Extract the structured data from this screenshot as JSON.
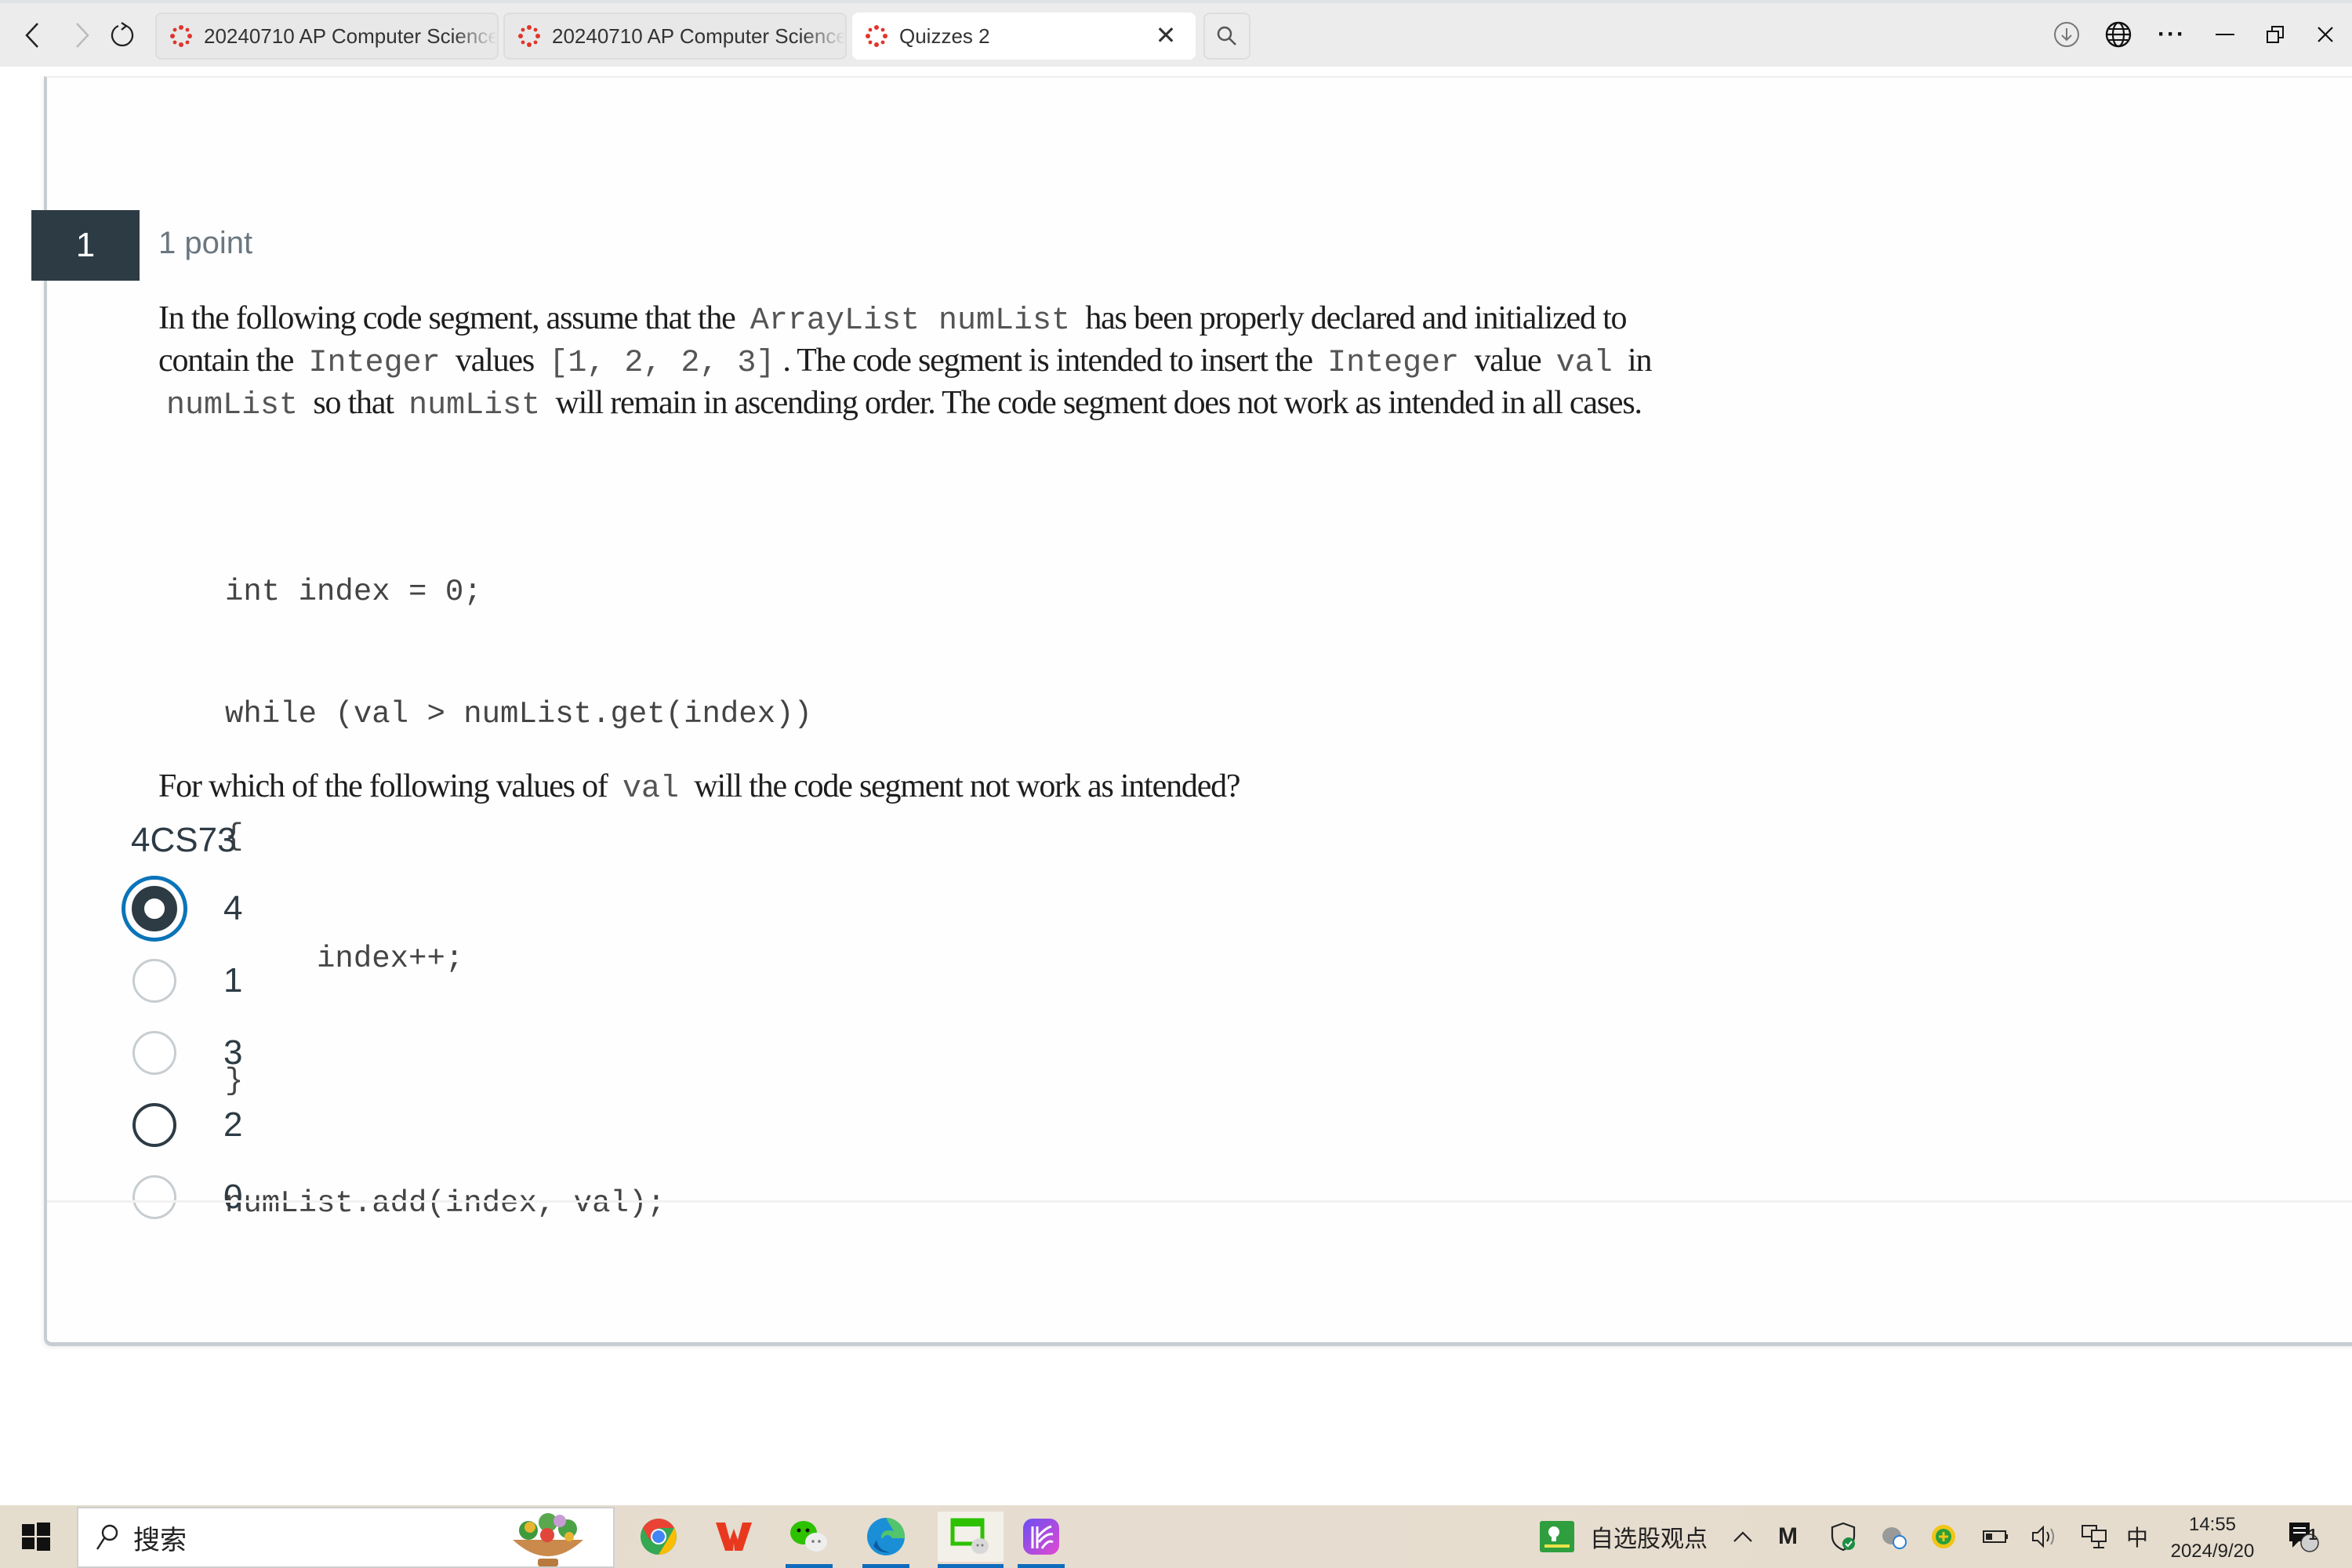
{
  "browser": {
    "tabs": [
      {
        "title": "20240710 AP Computer Science",
        "active": false
      },
      {
        "title": "20240710 AP Computer Science",
        "active": false
      },
      {
        "title": "Quizzes 2",
        "active": true
      }
    ],
    "icons": {
      "back": "chevron-left-icon",
      "forward": "chevron-right-icon",
      "refresh": "refresh-icon",
      "tab_favicon": "canvas-lms-icon",
      "tab_close": "close-icon",
      "tab_search": "search-icon",
      "downloads": "download-icon",
      "translate": "globe-icon",
      "more": "more-dots-icon",
      "minimize": "minimize-icon",
      "restore": "restore-icon",
      "close": "close-icon"
    },
    "glyphs": {
      "back": "‹",
      "forward": "›",
      "tab_close": "✕",
      "more": "···",
      "minimize": "—",
      "close": "✕"
    }
  },
  "question": {
    "number": "1",
    "points": "1 point",
    "text_parts": {
      "p1": "In the following code segment, assume that the",
      "c1": "ArrayList numList",
      "p2": "has been properly declared and initialized to contain the",
      "c2": "Integer",
      "p3": "values",
      "c3": "[1, 2, 2, 3]",
      "p4": ". The code segment is intended to insert the",
      "c4": "Integer",
      "p5": "value",
      "c5": "val",
      "p6": "in",
      "c6": "numList",
      "p7": "so that",
      "c7": "numList",
      "p8": "will remain in ascending order. The code segment does not work as intended in all cases."
    },
    "code_lines": [
      "int index = 0;",
      "while (val > numList.get(index))",
      "{",
      "     index++;",
      "}",
      "numList.add(index, val);"
    ],
    "prompt": {
      "before": "For which of the following values of",
      "code": "val",
      "after": "will the code segment not work as intended?"
    },
    "label": "4CS73",
    "answers": [
      {
        "label": "4",
        "selected": true,
        "hover": false
      },
      {
        "label": "1",
        "selected": false,
        "hover": false
      },
      {
        "label": "3",
        "selected": false,
        "hover": false
      },
      {
        "label": "2",
        "selected": false,
        "hover": true
      },
      {
        "label": "0",
        "selected": false,
        "hover": false
      }
    ],
    "colors": {
      "number_bg": "#2d3b45",
      "focus_ring": "#0a74b9",
      "radio_fill": "#2d3b45",
      "points_text": "#6b7780"
    }
  },
  "taskbar": {
    "search_placeholder": "搜索",
    "apps": [
      {
        "name": "chrome-icon",
        "running": false
      },
      {
        "name": "wps-office-icon",
        "running": false
      },
      {
        "name": "wechat-icon",
        "running": true
      },
      {
        "name": "edge-icon",
        "running": true
      },
      {
        "name": "wechat-screen-icon",
        "running": true
      },
      {
        "name": "kuake-app-icon",
        "running": true
      }
    ],
    "widget_label": "自选股观点",
    "tray_icons": [
      "chevron-up-icon",
      "m-app-icon",
      "security-shield-icon",
      "cloud-sync-icon",
      "plus-badge-icon",
      "battery-icon",
      "volume-icon",
      "network-icon",
      "ime-chinese-icon"
    ],
    "ime": "中",
    "time": "14:55",
    "date": "2024/9/20",
    "notification_count": "1"
  }
}
